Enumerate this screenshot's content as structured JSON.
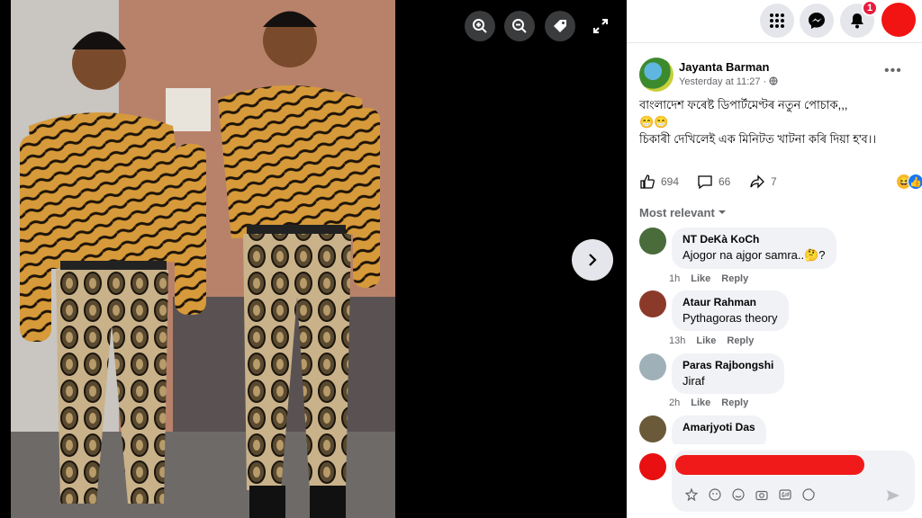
{
  "post": {
    "author": "Jayanta Barman",
    "time": "Yesterday at 11:27 ·",
    "line1": "বাংলাদেশ ফৰেষ্ট ডিপাৰ্টমেণ্টৰ নতুন পোচাক,,,",
    "emoji": "😁😁",
    "line2": "চিকাৰী দেখিলেই এক মিনিটত খাটনা কৰি দিয়া হ'ব।।"
  },
  "reactions": {
    "likes": "694",
    "comments": "66",
    "shares": "7"
  },
  "sort_label": "Most relevant",
  "comments": [
    {
      "name": "NT DeKà KoCh",
      "text": "Ajogor na ajgor samra..🤔?",
      "time": "1h",
      "like": "Like",
      "reply": "Reply",
      "color": "#4a6b3a"
    },
    {
      "name": "Ataur Rahman",
      "text": "Pythagoras theory",
      "time": "13h",
      "like": "Like",
      "reply": "Reply",
      "color": "#8b3a2a"
    },
    {
      "name": "Paras Rajbongshi",
      "text": "Jiraf",
      "time": "2h",
      "like": "Like",
      "reply": "Reply",
      "color": "#9fb0b8"
    },
    {
      "name": "Amarjyoti Das",
      "text": "",
      "time": "",
      "like": "",
      "reply": "",
      "color": "#6a5a3a"
    }
  ],
  "notifications": {
    "count": "1"
  },
  "icons": {
    "zoom_in": "zoom-in-icon",
    "zoom_out": "zoom-out-icon",
    "tag": "tag-icon",
    "expand": "expand-icon",
    "next": "chevron-right-icon",
    "menu": "grid-menu-icon",
    "messenger": "messenger-icon",
    "bell": "bell-icon"
  }
}
